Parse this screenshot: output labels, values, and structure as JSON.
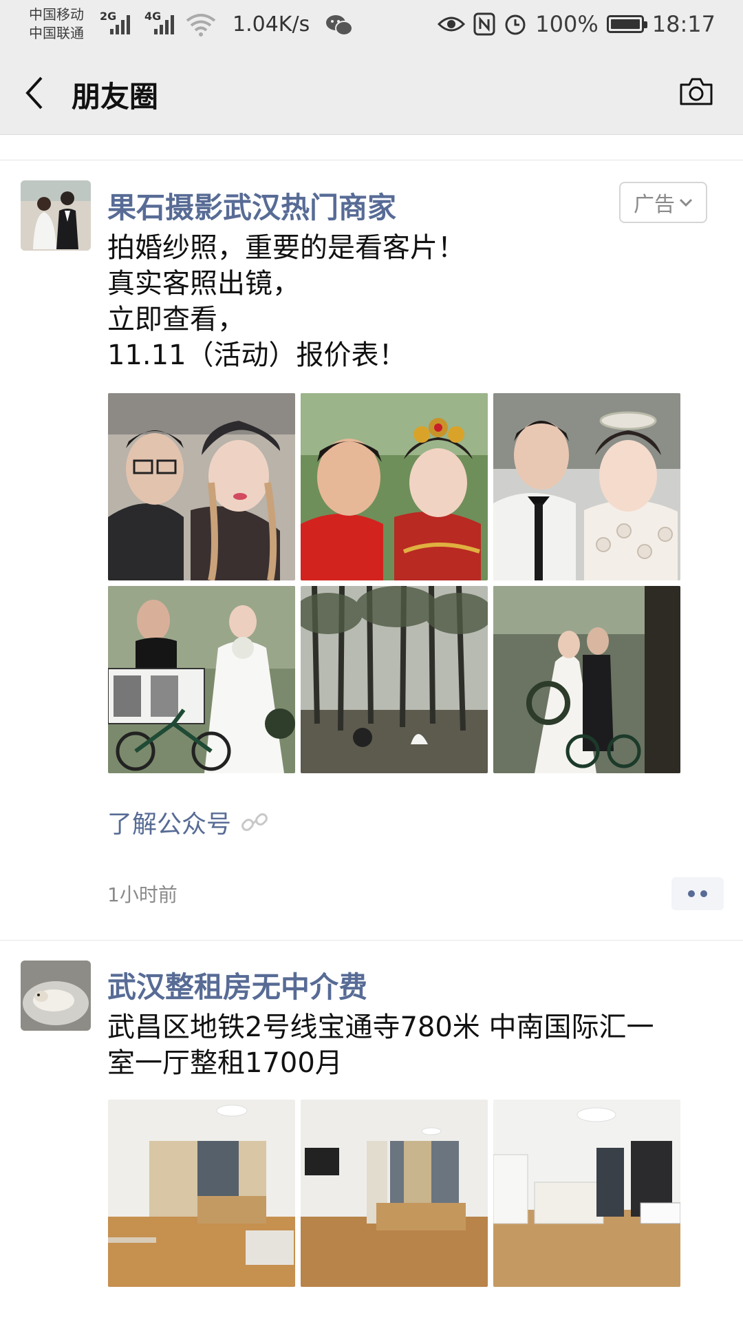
{
  "status_bar": {
    "carrier1": "中国移动",
    "carrier2": "中国联通",
    "net1": "2G",
    "net2": "4G",
    "speed": "1.04K/s",
    "battery": "100%",
    "battery_level": 1.0,
    "time": "18:17"
  },
  "nav": {
    "title": "朋友圈"
  },
  "posts": [
    {
      "author": "果石摄影武汉热门商家",
      "ad_label": "广告",
      "text": "拍婚纱照，重要的是看客片！\n真实客照出镜，\n立即查看，\n11.11（活动）报价表！",
      "link_label": "了解公众号",
      "time": "1小时前"
    },
    {
      "author": "武汉整租房无中介费",
      "text": "武昌区地铁2号线宝通寺780米 中南国际汇一\n室一厅整租1700月"
    }
  ],
  "colors": {
    "link_blue": "#576b95",
    "bar_bg": "#ededed",
    "muted_gray": "#8a8a8a"
  },
  "icons": [
    "back-arrow-icon",
    "camera-icon",
    "wechat-icon",
    "eye-icon",
    "nfc-icon",
    "alarm-icon",
    "battery-icon",
    "chevron-down-icon",
    "link-icon",
    "more-dots-icon"
  ]
}
